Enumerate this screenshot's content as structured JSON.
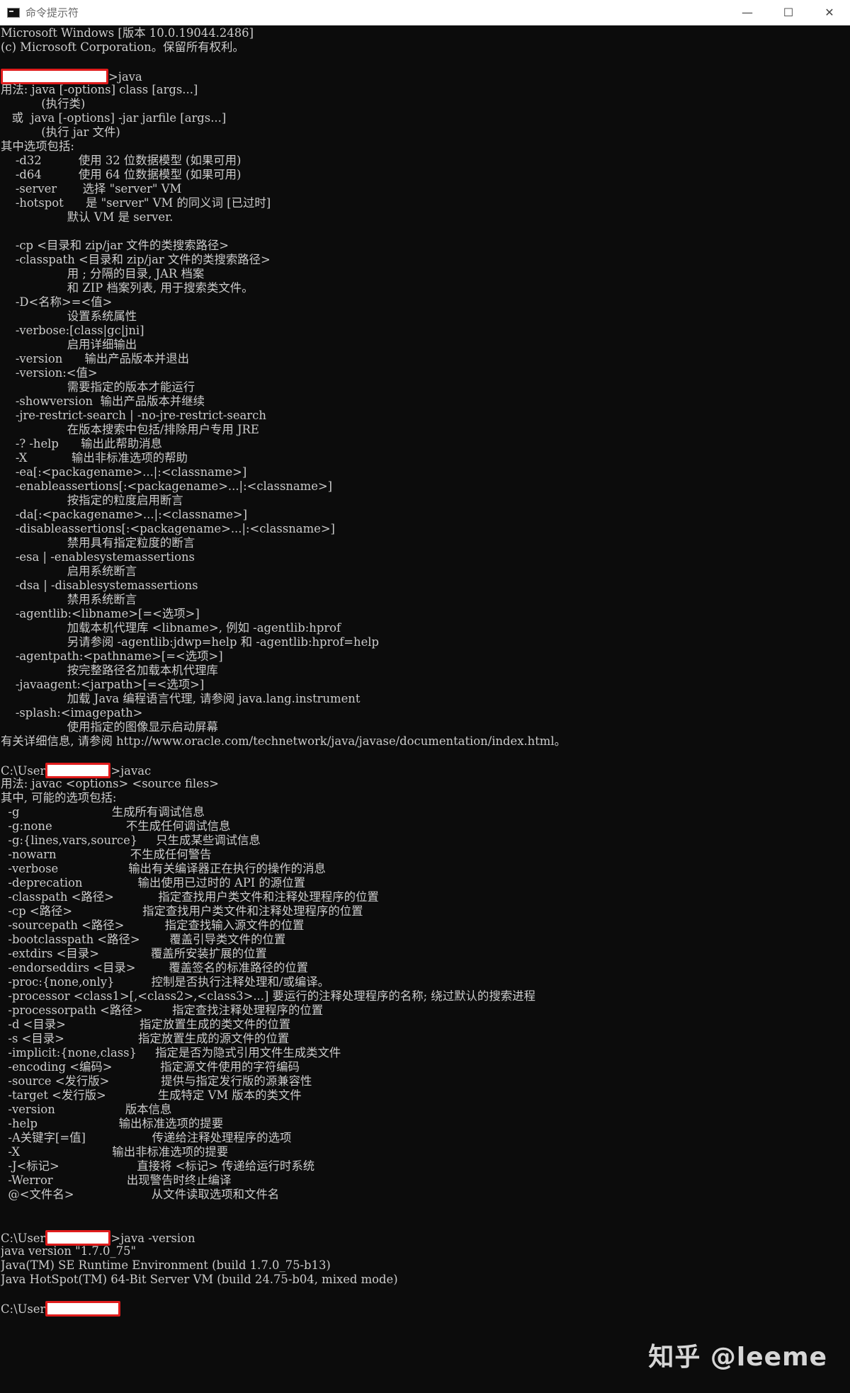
{
  "window": {
    "title": "命令提示符",
    "minimize_glyph": "—",
    "maximize_glyph": "☐",
    "close_glyph": "✕"
  },
  "console": {
    "lines": [
      {
        "text": "Microsoft Windows [版本 10.0.19044.2486]"
      },
      {
        "text": "(c) Microsoft Corporation。保留所有权利。"
      },
      {
        "text": ""
      },
      {
        "prefix": "",
        "redact_width": 152,
        "suffix": ">java"
      },
      {
        "text": "用法: java [-options] class [args...]"
      },
      {
        "text": "           (执行类)"
      },
      {
        "text": "   或  java [-options] -jar jarfile [args...]"
      },
      {
        "text": "           (执行 jar 文件)"
      },
      {
        "text": "其中选项包括:"
      },
      {
        "text": "    -d32          使用 32 位数据模型 (如果可用)"
      },
      {
        "text": "    -d64          使用 64 位数据模型 (如果可用)"
      },
      {
        "text": "    -server       选择 \"server\" VM"
      },
      {
        "text": "    -hotspot      是 \"server\" VM 的同义词 [已过时]"
      },
      {
        "text": "                  默认 VM 是 server."
      },
      {
        "text": ""
      },
      {
        "text": "    -cp <目录和 zip/jar 文件的类搜索路径>"
      },
      {
        "text": "    -classpath <目录和 zip/jar 文件的类搜索路径>"
      },
      {
        "text": "                  用 ; 分隔的目录, JAR 档案"
      },
      {
        "text": "                  和 ZIP 档案列表, 用于搜索类文件。"
      },
      {
        "text": "    -D<名称>=<值>"
      },
      {
        "text": "                  设置系统属性"
      },
      {
        "text": "    -verbose:[class|gc|jni]"
      },
      {
        "text": "                  启用详细输出"
      },
      {
        "text": "    -version      输出产品版本并退出"
      },
      {
        "text": "    -version:<值>"
      },
      {
        "text": "                  需要指定的版本才能运行"
      },
      {
        "text": "    -showversion  输出产品版本并继续"
      },
      {
        "text": "    -jre-restrict-search | -no-jre-restrict-search"
      },
      {
        "text": "                  在版本搜索中包括/排除用户专用 JRE"
      },
      {
        "text": "    -? -help      输出此帮助消息"
      },
      {
        "text": "    -X            输出非标准选项的帮助"
      },
      {
        "text": "    -ea[:<packagename>...|:<classname>]"
      },
      {
        "text": "    -enableassertions[:<packagename>...|:<classname>]"
      },
      {
        "text": "                  按指定的粒度启用断言"
      },
      {
        "text": "    -da[:<packagename>...|:<classname>]"
      },
      {
        "text": "    -disableassertions[:<packagename>...|:<classname>]"
      },
      {
        "text": "                  禁用具有指定粒度的断言"
      },
      {
        "text": "    -esa | -enablesystemassertions"
      },
      {
        "text": "                  启用系统断言"
      },
      {
        "text": "    -dsa | -disablesystemassertions"
      },
      {
        "text": "                  禁用系统断言"
      },
      {
        "text": "    -agentlib:<libname>[=<选项>]"
      },
      {
        "text": "                  加载本机代理库 <libname>, 例如 -agentlib:hprof"
      },
      {
        "text": "                  另请参阅 -agentlib:jdwp=help 和 -agentlib:hprof=help"
      },
      {
        "text": "    -agentpath:<pathname>[=<选项>]"
      },
      {
        "text": "                  按完整路径名加载本机代理库"
      },
      {
        "text": "    -javaagent:<jarpath>[=<选项>]"
      },
      {
        "text": "                  加载 Java 编程语言代理, 请参阅 java.lang.instrument"
      },
      {
        "text": "    -splash:<imagepath>"
      },
      {
        "text": "                  使用指定的图像显示启动屏幕"
      },
      {
        "text": "有关详细信息, 请参阅 http://www.oracle.com/technetwork/java/javase/documentation/index.html。"
      },
      {
        "text": ""
      },
      {
        "prefix": "C:\\User",
        "redact_width": 92,
        "suffix": ">javac"
      },
      {
        "text": "用法: javac <options> <source files>"
      },
      {
        "text": "其中, 可能的选项包括:"
      },
      {
        "text": "  -g                         生成所有调试信息"
      },
      {
        "text": "  -g:none                    不生成任何调试信息"
      },
      {
        "text": "  -g:{lines,vars,source}     只生成某些调试信息"
      },
      {
        "text": "  -nowarn                    不生成任何警告"
      },
      {
        "text": "  -verbose                   输出有关编译器正在执行的操作的消息"
      },
      {
        "text": "  -deprecation               输出使用已过时的 API 的源位置"
      },
      {
        "text": "  -classpath <路径>            指定查找用户类文件和注释处理程序的位置"
      },
      {
        "text": "  -cp <路径>                   指定查找用户类文件和注释处理程序的位置"
      },
      {
        "text": "  -sourcepath <路径>           指定查找输入源文件的位置"
      },
      {
        "text": "  -bootclasspath <路径>        覆盖引导类文件的位置"
      },
      {
        "text": "  -extdirs <目录>              覆盖所安装扩展的位置"
      },
      {
        "text": "  -endorseddirs <目录>         覆盖签名的标准路径的位置"
      },
      {
        "text": "  -proc:{none,only}          控制是否执行注释处理和/或编译。"
      },
      {
        "text": "  -processor <class1>[,<class2>,<class3>...] 要运行的注释处理程序的名称; 绕过默认的搜索进程"
      },
      {
        "text": "  -processorpath <路径>        指定查找注释处理程序的位置"
      },
      {
        "text": "  -d <目录>                    指定放置生成的类文件的位置"
      },
      {
        "text": "  -s <目录>                    指定放置生成的源文件的位置"
      },
      {
        "text": "  -implicit:{none,class}     指定是否为隐式引用文件生成类文件"
      },
      {
        "text": "  -encoding <编码>             指定源文件使用的字符编码"
      },
      {
        "text": "  -source <发行版>              提供与指定发行版的源兼容性"
      },
      {
        "text": "  -target <发行版>              生成特定 VM 版本的类文件"
      },
      {
        "text": "  -version                   版本信息"
      },
      {
        "text": "  -help                      输出标准选项的提要"
      },
      {
        "text": "  -A关键字[=值]                  传递给注释处理程序的选项"
      },
      {
        "text": "  -X                         输出非标准选项的提要"
      },
      {
        "text": "  -J<标记>                     直接将 <标记> 传递给运行时系统"
      },
      {
        "text": "  -Werror                    出现警告时终止编译"
      },
      {
        "text": "  @<文件名>                     从文件读取选项和文件名"
      },
      {
        "text": ""
      },
      {
        "text": ""
      },
      {
        "prefix": "C:\\User",
        "redact_width": 92,
        "suffix": ">java -version"
      },
      {
        "text": "java version \"1.7.0_75\""
      },
      {
        "text": "Java(TM) SE Runtime Environment (build 1.7.0_75-b13)"
      },
      {
        "text": "Java HotSpot(TM) 64-Bit Server VM (build 24.75-b04, mixed mode)"
      },
      {
        "text": ""
      },
      {
        "prefix": "C:\\User",
        "redact_width": 106,
        "suffix": ""
      }
    ]
  },
  "watermark": "知乎 @leeme",
  "colors": {
    "console_bg": "#0c0c0c",
    "console_fg": "#cccccc",
    "redact_border": "#e01c1c",
    "titlebar_bg": "#ffffff"
  }
}
